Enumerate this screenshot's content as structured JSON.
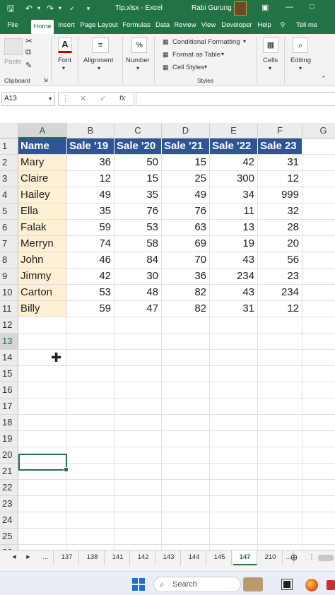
{
  "titlebar": {
    "file_name": "Tip.xlsx",
    "app_name": "Excel",
    "title_sep": " - ",
    "user_name": "Rabi Gurung",
    "accent_color": "#217346"
  },
  "ribbon_tabs": [
    "File",
    "Home",
    "Insert",
    "Page Layout",
    "Formulas",
    "Data",
    "Review",
    "View",
    "Developer",
    "Help",
    "Tell me"
  ],
  "active_tab": "Home",
  "ribbon": {
    "clipboard": {
      "paste": "Paste",
      "group": "Clipboard"
    },
    "font": {
      "label": "Font"
    },
    "alignment": {
      "label": "Alignment"
    },
    "number": {
      "label": "Number"
    },
    "styles": {
      "conditional": "Conditional Formatting",
      "format_table": "Format as Table",
      "cell_styles": "Cell Styles",
      "group": "Styles"
    },
    "cells": {
      "label": "Cells"
    },
    "editing": {
      "label": "Editing"
    }
  },
  "formula_bar": {
    "name_box": "A13",
    "fx": "fx",
    "formula": ""
  },
  "sheet": {
    "columns": [
      "A",
      "B",
      "C",
      "D",
      "E",
      "F",
      "G"
    ],
    "header_row": [
      "Name",
      "Sale '19",
      "Sale '20",
      "Sale '21",
      "Sale '22",
      "Sale 23"
    ],
    "rows": [
      [
        "Mary",
        "36",
        "50",
        "15",
        "42",
        "31"
      ],
      [
        "Claire",
        "12",
        "15",
        "25",
        "300",
        "12"
      ],
      [
        "Hailey",
        "49",
        "35",
        "49",
        "34",
        "999"
      ],
      [
        "Ella",
        "35",
        "76",
        "76",
        "11",
        "32"
      ],
      [
        "Falak",
        "59",
        "53",
        "63",
        "13",
        "28"
      ],
      [
        "Merryn",
        "74",
        "58",
        "69",
        "19",
        "20"
      ],
      [
        "John",
        "46",
        "84",
        "70",
        "43",
        "56"
      ],
      [
        "Jimmy",
        "42",
        "30",
        "36",
        "234",
        "23"
      ],
      [
        "Carton",
        "53",
        "48",
        "82",
        "43",
        "234"
      ],
      [
        "Billy",
        "59",
        "47",
        "82",
        "31",
        "12"
      ]
    ],
    "row_numbers": [
      "1",
      "2",
      "3",
      "4",
      "5",
      "6",
      "7",
      "8",
      "9",
      "10",
      "11",
      "12",
      "13",
      "14",
      "15",
      "16",
      "17",
      "18",
      "19",
      "20",
      "21",
      "22",
      "23",
      "24",
      "25",
      "26"
    ],
    "selected_cell": "A13",
    "header_fill": "#2f5597",
    "name_fill": "#fdf0d5"
  },
  "sheet_tabs": [
    "...",
    "137",
    "138",
    "141",
    "142",
    "143",
    "144",
    "145",
    "147",
    "210",
    "..."
  ],
  "active_sheet": "147",
  "taskbar": {
    "search_placeholder": "Search"
  }
}
